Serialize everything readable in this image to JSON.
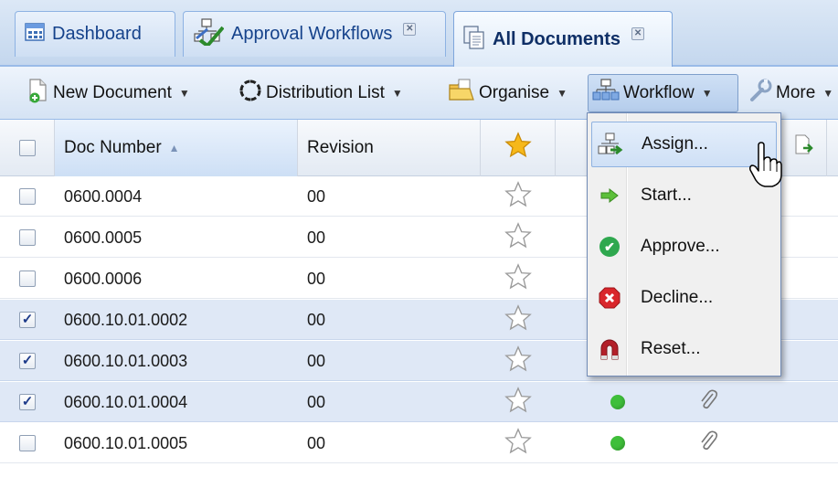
{
  "tabs": [
    {
      "label": "Dashboard",
      "icon": "dashboard-icon",
      "closable": false,
      "active": false
    },
    {
      "label": "Approval Workflows",
      "icon": "approval-workflows-icon",
      "closable": true,
      "active": false
    },
    {
      "label": "All Documents",
      "icon": "documents-icon",
      "closable": true,
      "active": true
    }
  ],
  "toolbar": {
    "new_document": "New Document",
    "distribution_list": "Distribution List",
    "organise": "Organise",
    "workflow": "Workflow",
    "more": "More"
  },
  "grid": {
    "columns": {
      "doc_number": "Doc Number",
      "revision": "Revision"
    },
    "rows": [
      {
        "doc_number": "0600.0004",
        "revision": "00",
        "checked": false,
        "status": "",
        "attachment": false
      },
      {
        "doc_number": "0600.0005",
        "revision": "00",
        "checked": false,
        "status": "",
        "attachment": false
      },
      {
        "doc_number": "0600.0006",
        "revision": "00",
        "checked": false,
        "status": "",
        "attachment": false
      },
      {
        "doc_number": "0600.10.01.0002",
        "revision": "00",
        "checked": true,
        "status": "",
        "attachment": false
      },
      {
        "doc_number": "0600.10.01.0003",
        "revision": "00",
        "checked": true,
        "status": "",
        "attachment": false
      },
      {
        "doc_number": "0600.10.01.0004",
        "revision": "00",
        "checked": true,
        "status": "green",
        "attachment": true
      },
      {
        "doc_number": "0600.10.01.0005",
        "revision": "00",
        "checked": false,
        "status": "green",
        "attachment": true
      }
    ]
  },
  "workflow_menu": {
    "items": [
      {
        "label": "Assign...",
        "icon": "assign-icon"
      },
      {
        "label": "Start...",
        "icon": "start-arrow-icon"
      },
      {
        "label": "Approve...",
        "icon": "approve-check-icon"
      },
      {
        "label": "Decline...",
        "icon": "decline-stop-icon"
      },
      {
        "label": "Reset...",
        "icon": "reset-magnet-icon"
      }
    ]
  },
  "colors": {
    "tab_text": "#15428b",
    "selection": "#dfe8f6",
    "status_green": "#3fbf3a",
    "approve": "#2fa84f",
    "decline": "#d9262b",
    "reset": "#b3202a"
  }
}
